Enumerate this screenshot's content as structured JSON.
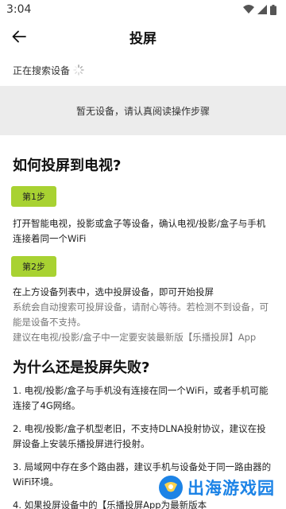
{
  "status_bar": {
    "time": "3:04"
  },
  "app_bar": {
    "title": "投屏"
  },
  "search": {
    "status_label": "正在搜索设备",
    "empty_message": "暂无设备，请认真阅读操作步骤"
  },
  "guide": {
    "title": "如何投屏到电视?",
    "step1_label": "第1步",
    "step1_text": "打开智能电视，投影或盒子等设备，确认电视/投影/盒子与手机连接着同一个WiFi",
    "step2_label": "第2步",
    "step2_text": "在上方设备列表中，选中投屏设备，即可开始投屏",
    "step2_note": "系统会自动搜索可投屏设备，请耐心等待。若检测不到设备，可能是设备不支持。",
    "step2_tip": "建议在电视/投影/盒子中一定要安装最新版【乐播投屏】App"
  },
  "faq": {
    "title": "为什么还是投屏失败?",
    "items": [
      "1. 电视/投影/盒子与手机没有连接在同一个WiFi，或者手机可能连接了4G网络。",
      "2. 电视/投影/盒子机型老旧，不支持DLNA投射协议，建议在投屏设备上安装乐播投屏进行投射。",
      "3. 局域网中存在多个路由器，建议手机与设备处于同一路由器的WiFi环境。",
      "4. 如果投屏设备中的【乐播投屏App为最新版本"
    ]
  },
  "watermark": {
    "text": "出海游戏园"
  },
  "colors": {
    "accent": "#a8d232",
    "panel": "#ececec",
    "watermark": "#1c83e6"
  },
  "icons": {
    "back": "arrow-left-icon",
    "spinner": "loading-spinner-icon",
    "wifi": "wifi-icon",
    "signal": "signal-icon",
    "battery": "battery-icon"
  }
}
